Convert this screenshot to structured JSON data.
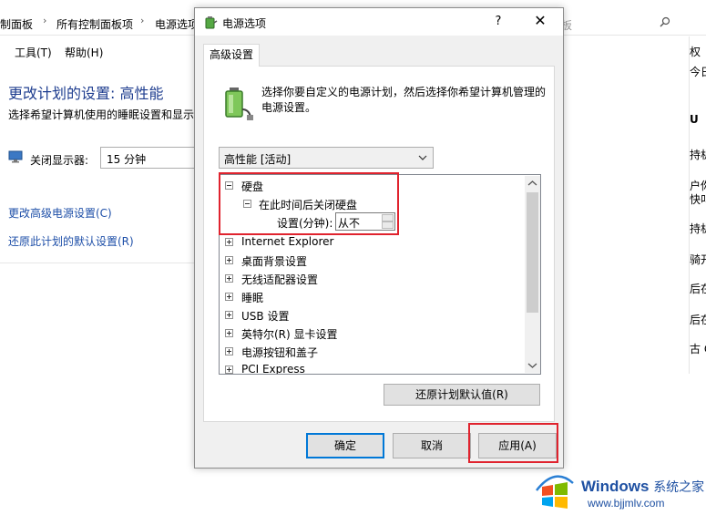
{
  "background_window": {
    "breadcrumbs": [
      "制面板",
      "所有控制面板项",
      "电源选项"
    ],
    "search_placeholder": "板",
    "menu": [
      "工具(T)",
      "帮助(H)"
    ],
    "page_title": "更改计划的设置: 高性能",
    "subtitle": "选择希望计算机使用的睡眠设置和显示",
    "display_off_label": "关闭显示器:",
    "display_off_value": "15 分钟",
    "links": [
      "更改高级电源设置(C)",
      "还原此计划的默认设置(R)"
    ],
    "right_panel_items": [
      "权",
      "今日",
      "U",
      "持机",
      "户你",
      "快叫",
      "持机",
      "骑开",
      "后在",
      "后在",
      "古 C"
    ]
  },
  "dialog": {
    "title": "电源选项",
    "help_symbol": "?",
    "close_symbol": "✕",
    "tab_label": "高级设置",
    "intro_text": "选择你要自定义的电源计划，然后选择你希望计算机管理的电源设置。",
    "plan_select_value": "高性能 [活动]",
    "tree": {
      "hard_disk": "硬盘",
      "turn_off_after": "在此时间后关闭硬盘",
      "setting_label": "设置(分钟):",
      "setting_value": "从不",
      "items": [
        "Internet Explorer",
        "桌面背景设置",
        "无线适配器设置",
        "睡眠",
        "USB 设置",
        "英特尔(R) 显卡设置",
        "电源按钮和盖子",
        "PCI Express"
      ]
    },
    "restore_defaults_label": "还原计划默认值(R)",
    "buttons": {
      "ok": "确定",
      "cancel": "取消",
      "apply": "应用(A)"
    }
  },
  "watermark": {
    "brand": "Windows",
    "brand_suffix": "系统之家",
    "url": "www.bjjmlv.com"
  },
  "colors": {
    "highlight_box": "#e0232e",
    "link": "#1e4fa8",
    "accent": "#0078d7"
  },
  "icons": [
    "search-icon",
    "display-icon",
    "power-options-icon",
    "battery-plug-icon",
    "chevron-down-icon",
    "close-icon",
    "windows-logo-icon"
  ]
}
